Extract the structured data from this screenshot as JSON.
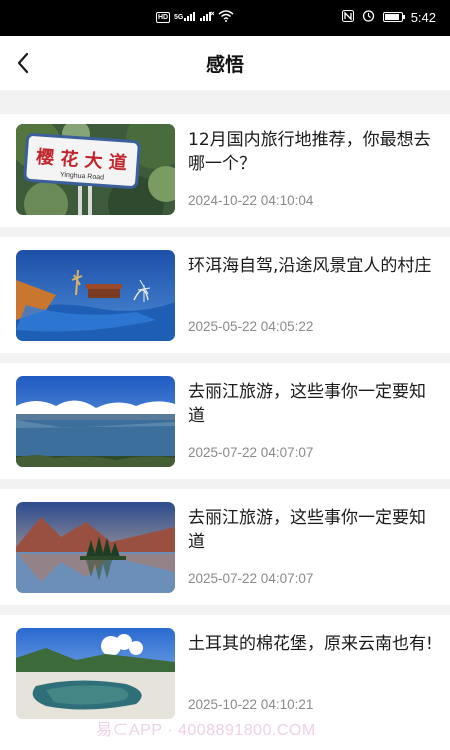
{
  "status_bar": {
    "time": "5:42",
    "left_indicators": "HD 5G",
    "icons": [
      "hd-icon",
      "signal-5g-icon",
      "signal-icon",
      "wifi-icon",
      "nfc-icon",
      "alarm-icon",
      "battery-icon"
    ],
    "battery_level": 0.9
  },
  "header": {
    "title": "感悟",
    "back_icon": "chevron-left-icon"
  },
  "articles": [
    {
      "title": "12月国内旅行地推荐，你最想去哪一个？",
      "date": "2024-10-22 04:10:04",
      "image": "yinghua-road-sign"
    },
    {
      "title": "环洱海自驾,沿途风景宜人的村庄",
      "date": "2025-05-22 04:05:22",
      "image": "erhai-lake-village"
    },
    {
      "title": "去丽江旅游，这些事你一定要知道",
      "date": "2025-07-22 04:07:07",
      "image": "mountain-lake"
    },
    {
      "title": "去丽江旅游，这些事你一定要知道",
      "date": "2025-07-22 04:07:07",
      "image": "lake-island-sunset"
    },
    {
      "title": "土耳其的棉花堡，原来云南也有!",
      "date": "2025-10-22 04:10:21",
      "image": "white-terraces-pool"
    }
  ],
  "watermark": "易⊂APP · 4008891800.COM",
  "colors": {
    "background": "#ffffff",
    "separator": "#f2f2f2",
    "date_text": "#8a8a8a",
    "status_bar": "#000000"
  }
}
